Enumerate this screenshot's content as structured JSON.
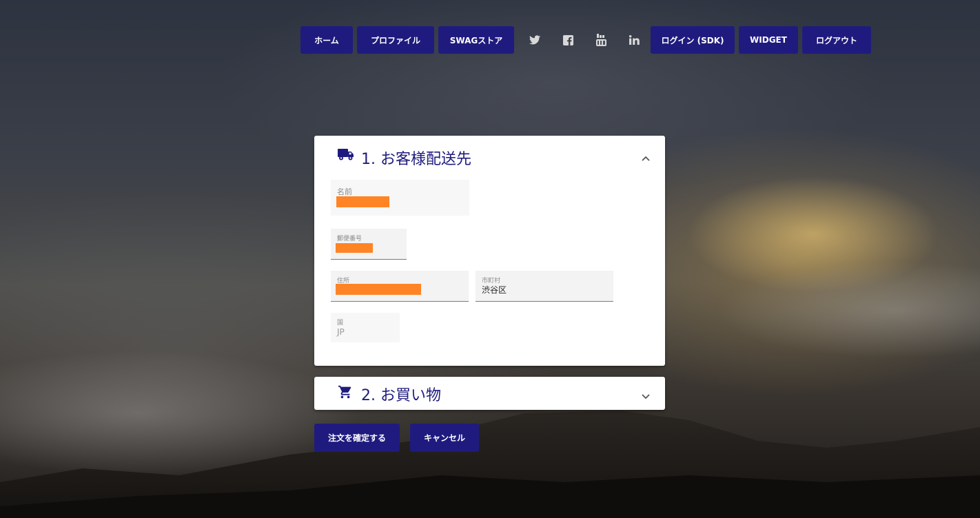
{
  "nav": {
    "items": [
      {
        "label": "ホーム"
      },
      {
        "label": "プロファイル"
      },
      {
        "label": "SWAGストア"
      }
    ],
    "social": [
      {
        "icon": "twitter-icon"
      },
      {
        "icon": "facebook-icon"
      },
      {
        "icon": "youtube-icon"
      },
      {
        "icon": "linkedin-icon"
      }
    ],
    "right_items": [
      {
        "label": "ログイン (SDK)"
      },
      {
        "label": "WIDGET"
      },
      {
        "label": "ログアウト"
      }
    ]
  },
  "shipping": {
    "title": "1. お客様配送先",
    "icon": "truck-icon",
    "expanded": true,
    "fields": {
      "name": {
        "label": "名前",
        "value_redacted": true
      },
      "postal": {
        "label": "郵便番号",
        "value_redacted": true
      },
      "address": {
        "label": "住所",
        "value_redacted": true
      },
      "city": {
        "label": "市町村",
        "value": "渋谷区"
      },
      "country": {
        "label": "国",
        "value": "JP"
      }
    }
  },
  "shopping": {
    "title": "2. お買い物",
    "icon": "cart-icon",
    "expanded": false
  },
  "actions": {
    "confirm_label": "注文を確定する",
    "cancel_label": "キャンセル"
  },
  "colors": {
    "primary": "#1f1b7e",
    "redaction": "#ff8426",
    "panel_bg": "#ffffff"
  }
}
